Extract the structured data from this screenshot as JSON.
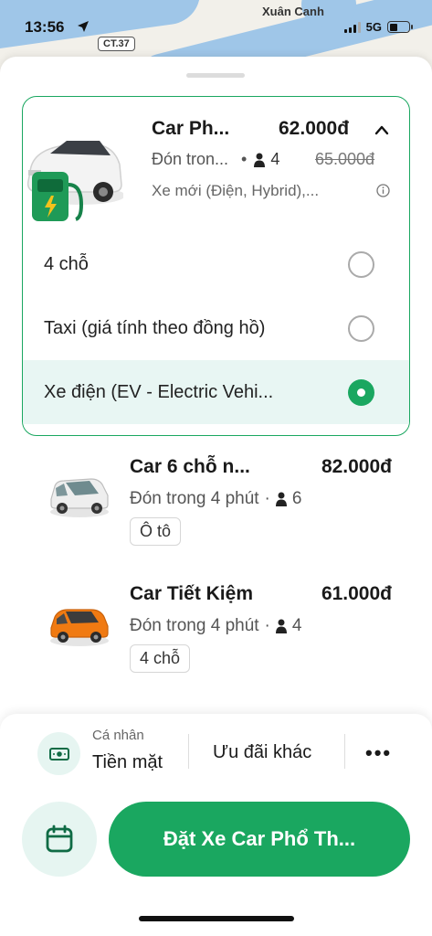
{
  "status_bar": {
    "time": "13:56",
    "network": "5G"
  },
  "map": {
    "place_label": "Xuân Canh",
    "road_badge": "CT.37"
  },
  "selected_service": {
    "name": "Car Ph...",
    "price": "62.000đ",
    "pickup": "Đón tron...",
    "seats": "4",
    "old_price": "65.000đ",
    "description": "Xe mới (Điện, Hybrid),..."
  },
  "options": [
    {
      "label": "4 chỗ",
      "selected": false
    },
    {
      "label": "Taxi (giá tính theo đồng hồ)",
      "selected": false
    },
    {
      "label": "Xe điện (EV - Electric Vehi...",
      "selected": true
    }
  ],
  "services": [
    {
      "name": "Car 6 chỗ n...",
      "price": "82.000đ",
      "pickup": "Đón trong 4 phút",
      "seats": "6",
      "tag": "Ô tô",
      "car_color": "white-icon"
    },
    {
      "name": "Car Tiết Kiệm",
      "price": "61.000đ",
      "pickup": "Đón trong 4 phút",
      "seats": "4",
      "tag": "4 chỗ",
      "car_color": "orange-icon"
    }
  ],
  "payment": {
    "type_label": "Cá nhân",
    "method": "Tiền mặt",
    "promo": "Ưu đãi khác",
    "more": "•••"
  },
  "book_button": "Đặt Xe Car Phổ Th...",
  "colors": {
    "accent": "#1aa760",
    "accent_light": "#e6f5f1"
  }
}
